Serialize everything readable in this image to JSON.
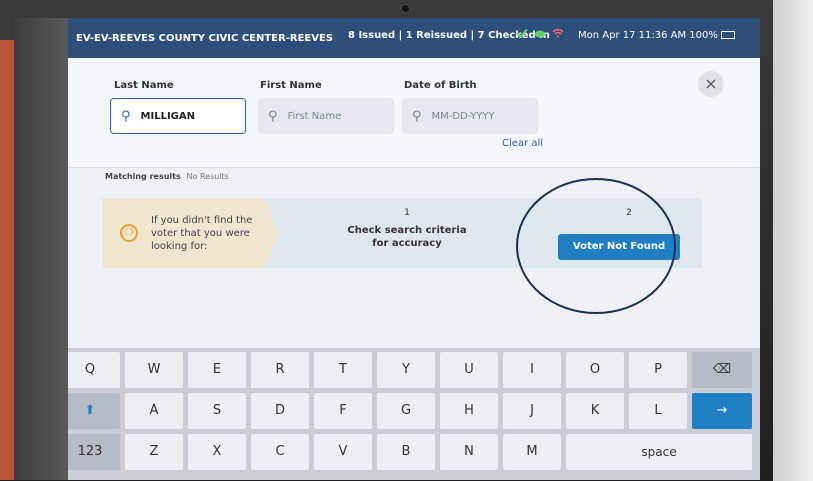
{
  "statusbar": {
    "location": "EV-EV-REEVES COUNTY CIVIC CENTER-REEVES",
    "counts": "8 Issued | 1 Reissued | 7 Checked In",
    "datetime": "Mon Apr 17  11:36 AM  100%"
  },
  "search": {
    "last_name_label": "Last Name",
    "last_name_value": "MILLIGAN",
    "first_name_label": "First Name",
    "first_name_placeholder": "First Name",
    "dob_label": "Date of Birth",
    "dob_placeholder": "MM-DD-YYYY",
    "clear_all": "Clear all",
    "close_glyph": "×",
    "search_glyph": "🔍"
  },
  "results": {
    "label": "Matching results",
    "status": "No Results",
    "hint_text": "If you didn't find the voter that you were looking for:",
    "step1_number": "1",
    "step1_text": "Check search criteria for accuracy",
    "step2_number": "2",
    "voter_not_found": "Voter Not Found"
  },
  "keyboard": {
    "row1": [
      "Q",
      "W",
      "E",
      "R",
      "T",
      "Y",
      "U",
      "I",
      "O",
      "P"
    ],
    "row2": [
      "A",
      "S",
      "D",
      "F",
      "G",
      "H",
      "J",
      "K",
      "L"
    ],
    "row3": [
      "Z",
      "X",
      "C",
      "V",
      "B",
      "N",
      "M"
    ],
    "numbers_key": "123",
    "space_key": "space",
    "backspace_glyph": "⌫",
    "shift_glyph": "⬆",
    "enter_glyph": "→"
  },
  "colors": {
    "statusbar": "#2d4f7c",
    "accent": "#1f7fc2",
    "hint": "#f1e6cf"
  },
  "icons": {
    "status": [
      "check-icon",
      "cloud-icon",
      "wifi-icon"
    ],
    "hint": "lifebuoy-icon"
  }
}
